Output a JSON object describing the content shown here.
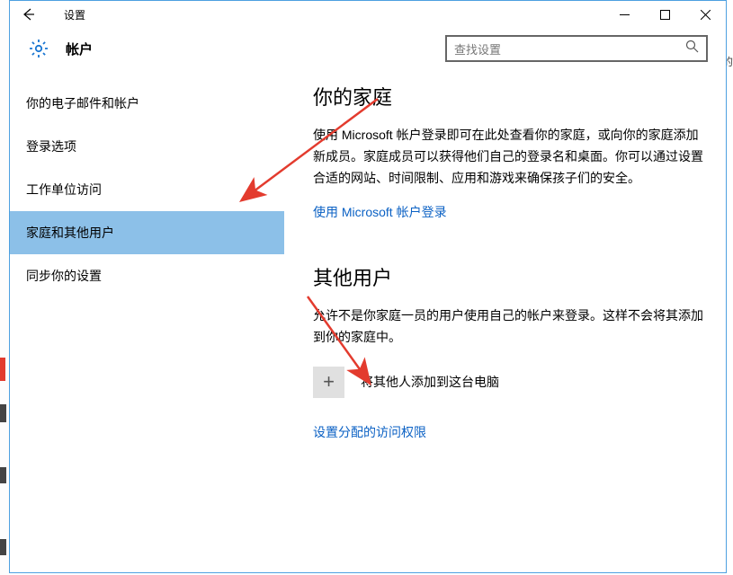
{
  "window": {
    "title": "设置"
  },
  "header": {
    "account_label": "帐户",
    "search_placeholder": "查找设置"
  },
  "sidebar": {
    "items": [
      {
        "label": "你的电子邮件和帐户"
      },
      {
        "label": "登录选项"
      },
      {
        "label": "工作单位访问"
      },
      {
        "label": "家庭和其他用户"
      },
      {
        "label": "同步你的设置"
      }
    ],
    "active_index": 3
  },
  "content": {
    "family": {
      "heading": "你的家庭",
      "description": "使用 Microsoft 帐户登录即可在此处查看你的家庭，或向你的家庭添加新成员。家庭成员可以获得他们自己的登录名和桌面。你可以通过设置合适的网站、时间限制、应用和游戏来确保孩子们的安全。",
      "signin_link": "使用 Microsoft 帐户登录"
    },
    "others": {
      "heading": "其他用户",
      "description": "允许不是你家庭一员的用户使用自己的帐户来登录。这样不会将其添加到你的家庭中。",
      "add_label": "将其他人添加到这台电脑",
      "assigned_link": "设置分配的访问权限"
    }
  },
  "stray": {
    "right_char": "的"
  }
}
